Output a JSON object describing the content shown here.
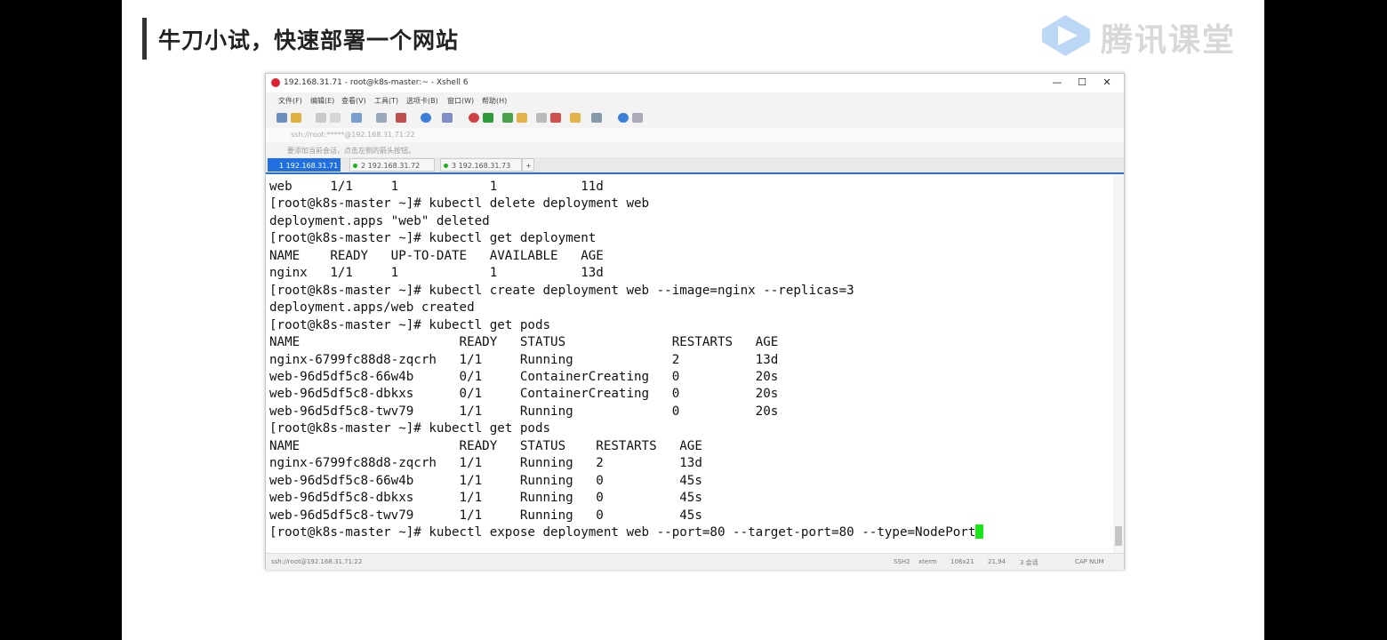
{
  "slide": {
    "title": "牛刀小试，快速部署一个网站",
    "logo_text": "腾讯课堂"
  },
  "window": {
    "title": "192.168.31.71 - root@k8s-master:~ - Xshell 6",
    "menu": [
      "文件(F)",
      "编辑(E)",
      "查看(V)",
      "工具(T)",
      "选项卡(B)",
      "窗口(W)",
      "帮助(H)"
    ],
    "address": "ssh://root:*****@192.168.31.71:22",
    "hint": "要添加当前会话，点击左侧的箭头按钮。",
    "tabs": [
      "1 192.168.31.71",
      "2 192.168.31.72",
      "3 192.168.31.73"
    ],
    "status": {
      "session": "ssh://root@192.168.31.71:22",
      "ssh": "SSH2",
      "term": "xterm",
      "size": "108x21",
      "pos": "21,94",
      "sessions": "3 会话",
      "caps": "CAP  NUM"
    }
  },
  "terminal": {
    "lines": [
      "web     1/1     1            1           11d",
      "[root@k8s-master ~]# kubectl delete deployment web",
      "deployment.apps \"web\" deleted",
      "[root@k8s-master ~]# kubectl get deployment",
      "NAME    READY   UP-TO-DATE   AVAILABLE   AGE",
      "nginx   1/1     1            1           13d",
      "[root@k8s-master ~]# kubectl create deployment web --image=nginx --replicas=3",
      "deployment.apps/web created",
      "[root@k8s-master ~]# kubectl get pods",
      "NAME                     READY   STATUS              RESTARTS   AGE",
      "nginx-6799fc88d8-zqcrh   1/1     Running             2          13d",
      "web-96d5df5c8-66w4b      0/1     ContainerCreating   0          20s",
      "web-96d5df5c8-dbkxs      0/1     ContainerCreating   0          20s",
      "web-96d5df5c8-twv79      1/1     Running             0          20s",
      "[root@k8s-master ~]# kubectl get pods",
      "NAME                     READY   STATUS    RESTARTS   AGE",
      "nginx-6799fc88d8-zqcrh   1/1     Running   2          13d",
      "web-96d5df5c8-66w4b      1/1     Running   0          45s",
      "web-96d5df5c8-dbkxs      1/1     Running   0          45s",
      "web-96d5df5c8-twv79      1/1     Running   0          45s"
    ],
    "current_command": "[root@k8s-master ~]# kubectl expose deployment web --port=80 --target-port=80 --type=NodePort"
  }
}
